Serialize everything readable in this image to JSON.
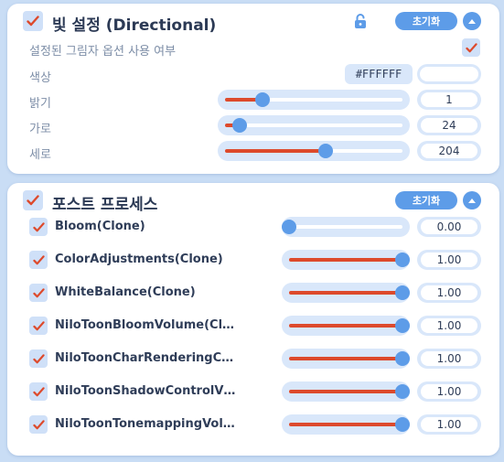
{
  "light_panel": {
    "title": "빛 설정 (Directional)",
    "checked": true,
    "reset_label": "초기화",
    "shadow_option_label": "설정된 그림자 옵션 사용 여부",
    "shadow_option_checked": true,
    "color_label": "색상",
    "color_hex": "#FFFFFF",
    "color_value": "#FFFFFF",
    "sliders": [
      {
        "label": "밝기",
        "value": "1",
        "fraction": 0.21
      },
      {
        "label": "가로",
        "value": "24",
        "fraction": 0.085
      },
      {
        "label": "세로",
        "value": "204",
        "fraction": 0.565
      }
    ]
  },
  "post_panel": {
    "title": "포스트 프로세스",
    "checked": true,
    "reset_label": "초기화",
    "items": [
      {
        "label": "Bloom(Clone)",
        "checked": true,
        "value": "0.00",
        "fraction": 0.0
      },
      {
        "label": "ColorAdjustments(Clone)",
        "checked": true,
        "value": "1.00",
        "fraction": 1.0
      },
      {
        "label": "WhiteBalance(Clone)",
        "checked": true,
        "value": "1.00",
        "fraction": 1.0
      },
      {
        "label": "NiloToonBloomVolume(Cl…",
        "checked": true,
        "value": "1.00",
        "fraction": 1.0
      },
      {
        "label": "NiloToonCharRenderingC…",
        "checked": true,
        "value": "1.00",
        "fraction": 1.0
      },
      {
        "label": "NiloToonShadowControlV…",
        "checked": true,
        "value": "1.00",
        "fraction": 1.0
      },
      {
        "label": "NiloToonTonemappingVol…",
        "checked": true,
        "value": "1.00",
        "fraction": 1.0
      }
    ]
  },
  "icons": {
    "check": "check-icon",
    "lock": "lock-icon",
    "collapse": "chevron-up-icon"
  },
  "colors": {
    "accent": "#5d9ce8",
    "fill": "#dd4a2c",
    "check": "#dd4a2c",
    "control_bg": "#d9e7fa",
    "background": "#c9ddf5"
  }
}
